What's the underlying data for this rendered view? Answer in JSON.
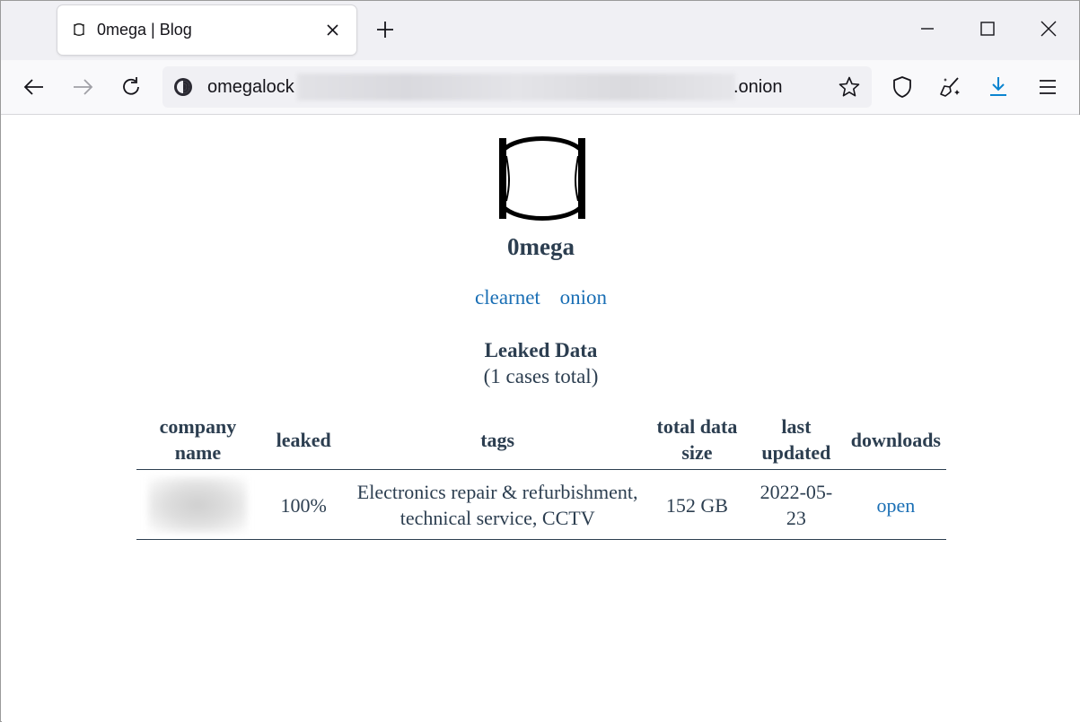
{
  "browser": {
    "tab_title": "0mega | Blog",
    "url_prefix": "omegalock",
    "url_suffix": ".onion"
  },
  "site": {
    "name": "0mega",
    "links": [
      "clearnet",
      "onion"
    ],
    "section_title": "Leaked Data",
    "section_subtitle": "(1 cases total)"
  },
  "table": {
    "headers": [
      "company name",
      "leaked",
      "tags",
      "total data size",
      "last updated",
      "downloads"
    ],
    "rows": [
      {
        "company_name": "",
        "leaked": "100%",
        "tags": "Electronics repair & refurbishment, technical service, CCTV",
        "total_size": "152 GB",
        "last_updated": "2022-05-23",
        "download": "open"
      }
    ]
  }
}
